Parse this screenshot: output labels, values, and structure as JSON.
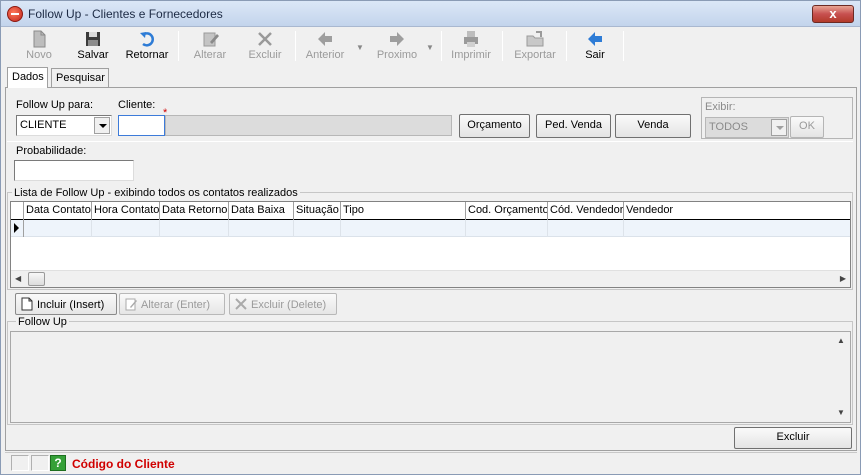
{
  "window": {
    "title": "Follow Up - Clientes e Fornecedores",
    "close_label": "x"
  },
  "toolbar": {
    "novo": "Novo",
    "salvar": "Salvar",
    "retornar": "Retornar",
    "alterar": "Alterar",
    "excluir": "Excluir",
    "anterior": "Anterior",
    "proximo": "Proximo",
    "imprimir": "Imprimir",
    "exportar": "Exportar",
    "sair": "Sair"
  },
  "tabs": {
    "dados": "Dados",
    "pesquisar": "Pesquisar"
  },
  "form": {
    "followup_para_label": "Follow Up para:",
    "followup_para_value": "CLIENTE",
    "cliente_label": "Cliente:",
    "cliente_code": "",
    "cliente_name": "",
    "required_mark": "*",
    "btn_orcamento": "Orçamento",
    "btn_ped_venda": "Ped. Venda",
    "btn_venda": "Venda",
    "exibir_label": "Exibir:",
    "exibir_value": "TODOS",
    "btn_ok": "OK",
    "probabilidade_label": "Probabilidade:",
    "probabilidade_value": ""
  },
  "list": {
    "title": "Lista de Follow Up - exibindo todos os contatos realizados",
    "columns": [
      "Data Contato",
      "Hora Contato",
      "Data Retorno",
      "Data Baixa",
      "Situação",
      "Tipo",
      "Cod. Orçamento",
      "Cód. Vendedor",
      "Vendedor"
    ]
  },
  "actions": {
    "incluir": "Incluir (Insert)",
    "alterar": "Alterar (Enter)",
    "excluir": "Excluir (Delete)"
  },
  "followup": {
    "title": "Follow Up"
  },
  "footer": {
    "excluir": "Excluir"
  },
  "status": {
    "help": "?",
    "text": "Código do Cliente"
  },
  "colors": {
    "accent_blue": "#2e7cd6",
    "status_red": "#d00000",
    "help_green": "#35a038"
  }
}
